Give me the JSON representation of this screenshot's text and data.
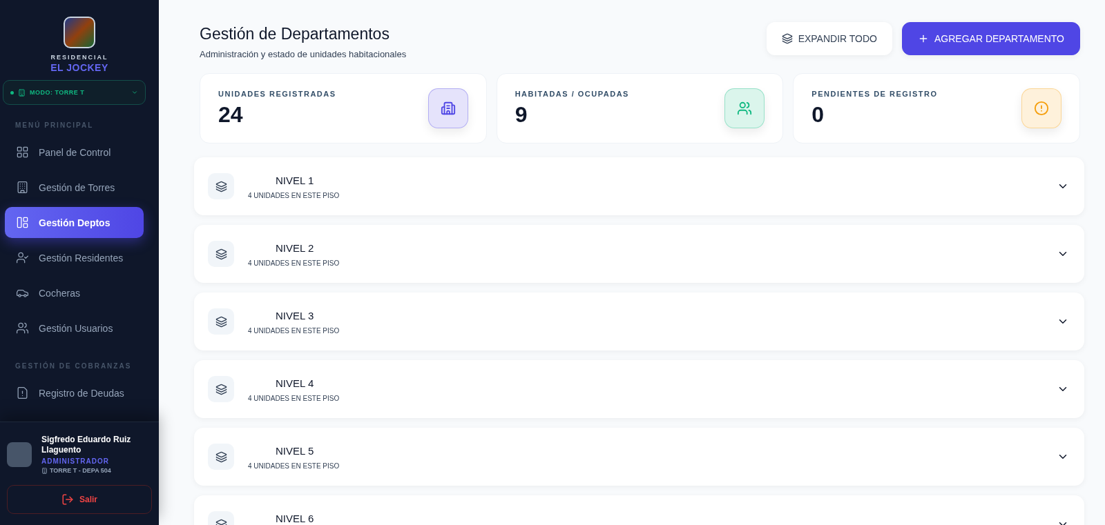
{
  "brand": {
    "kicker": "RESIDENCIAL",
    "name": "EL JOCKEY"
  },
  "mode_selector": {
    "label": "MODO: TORRE T"
  },
  "sidebar": {
    "sections": [
      {
        "title": "MENÚ PRINCIPAL",
        "items": [
          {
            "label": "Panel de Control",
            "selected": false
          },
          {
            "label": "Gestión de Torres",
            "selected": false
          },
          {
            "label": "Gestión Deptos",
            "selected": true
          },
          {
            "label": "Gestión Residentes",
            "selected": false
          },
          {
            "label": "Cocheras",
            "selected": false
          },
          {
            "label": "Gestión Usuarios",
            "selected": false
          }
        ]
      },
      {
        "title": "GESTIÓN DE COBRANZAS",
        "items": [
          {
            "label": "Registro de Deudas",
            "selected": false
          }
        ]
      }
    ]
  },
  "user": {
    "name": "Sigfredo Eduardo Ruiz Llaguento",
    "role": "ADMINISTRADOR",
    "location": "TORRE T - DEPA 504"
  },
  "logout": {
    "label": "Salir"
  },
  "header": {
    "title": "Gestión de Departamentos",
    "subtitle": "Administración y estado de unidades habitacionales"
  },
  "actions": {
    "expand": "EXPANDIR TODO",
    "add": "AGREGAR DEPARTAMENTO"
  },
  "stats": [
    {
      "label": "UNIDADES REGISTRADAS",
      "value": "24",
      "color": "#4f46e5"
    },
    {
      "label": "HABITADAS / OCUPADAS",
      "value": "9",
      "color": "#10b981"
    },
    {
      "label": "PENDIENTES DE REGISTRO",
      "value": "0",
      "color": "#f59e0b"
    }
  ],
  "floors": [
    {
      "title": "NIVEL 1",
      "subtitle": "4 UNIDADES EN ESTE PISO",
      "expanded": false
    },
    {
      "title": "NIVEL 2",
      "subtitle": "4 UNIDADES EN ESTE PISO",
      "expanded": false
    },
    {
      "title": "NIVEL 3",
      "subtitle": "4 UNIDADES EN ESTE PISO",
      "expanded": false
    },
    {
      "title": "NIVEL 4",
      "subtitle": "4 UNIDADES EN ESTE PISO",
      "expanded": false
    },
    {
      "title": "NIVEL 5",
      "subtitle": "4 UNIDADES EN ESTE PISO",
      "expanded": false
    },
    {
      "title": "NIVEL 6",
      "expanded": false
    }
  ]
}
